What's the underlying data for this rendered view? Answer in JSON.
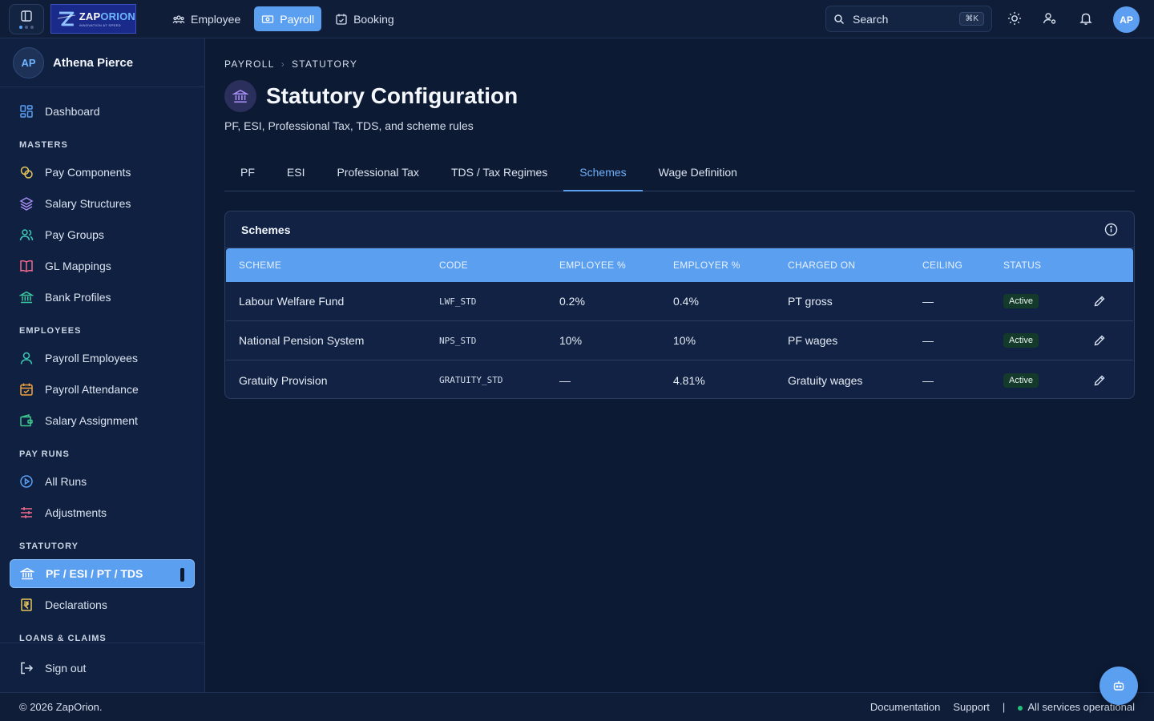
{
  "topbar": {
    "logo": {
      "wordmark_a": "ZAP",
      "wordmark_b": "ORION",
      "tagline": "INNOVATION AT SPEED"
    },
    "modules": [
      {
        "label": "Employee",
        "icon": "users-icon",
        "active": false
      },
      {
        "label": "Payroll",
        "icon": "banknote-icon",
        "active": true
      },
      {
        "label": "Booking",
        "icon": "calendar-check-icon",
        "active": false
      }
    ],
    "search": {
      "label": "Search",
      "shortcut": "⌘K"
    },
    "avatar_initials": "AP"
  },
  "sidebar": {
    "user": {
      "initials": "AP",
      "name": "Athena Pierce"
    },
    "items": {
      "dashboard": "Dashboard",
      "section_masters": "MASTERS",
      "pay_components": "Pay Components",
      "salary_structures": "Salary Structures",
      "pay_groups": "Pay Groups",
      "gl_mappings": "GL Mappings",
      "bank_profiles": "Bank Profiles",
      "section_employees": "EMPLOYEES",
      "payroll_employees": "Payroll Employees",
      "payroll_attendance": "Payroll Attendance",
      "salary_assignment": "Salary Assignment",
      "section_pay_runs": "PAY RUNS",
      "all_runs": "All Runs",
      "adjustments": "Adjustments",
      "section_statutory": "STATUTORY",
      "pf_esi_pt_tds": "PF / ESI / PT / TDS",
      "declarations": "Declarations",
      "section_loans": "LOANS & CLAIMS"
    },
    "sign_out": "Sign out"
  },
  "main": {
    "breadcrumb": [
      "PAYROLL",
      "STATUTORY"
    ],
    "title": "Statutory Configuration",
    "subtitle": "PF, ESI, Professional Tax, TDS, and scheme rules",
    "tabs": [
      "PF",
      "ESI",
      "Professional Tax",
      "TDS / Tax Regimes",
      "Schemes",
      "Wage Definition"
    ],
    "active_tab": "Schemes",
    "card_title": "Schemes",
    "columns": [
      "SCHEME",
      "CODE",
      "EMPLOYEE %",
      "EMPLOYER %",
      "CHARGED ON",
      "CEILING",
      "STATUS"
    ],
    "rows": [
      {
        "scheme": "Labour Welfare Fund",
        "code": "LWF_STD",
        "employee": "0.2%",
        "employer": "0.4%",
        "charged_on": "PT gross",
        "ceiling": "—",
        "status": "Active"
      },
      {
        "scheme": "National Pension System",
        "code": "NPS_STD",
        "employee": "10%",
        "employer": "10%",
        "charged_on": "PF wages",
        "ceiling": "—",
        "status": "Active"
      },
      {
        "scheme": "Gratuity Provision",
        "code": "GRATUITY_STD",
        "employee": "—",
        "employer": "4.81%",
        "charged_on": "Gratuity wages",
        "ceiling": "—",
        "status": "Active"
      }
    ]
  },
  "footer": {
    "copyright": "© 2026 ZapOrion.",
    "documentation": "Documentation",
    "support": "Support",
    "separator": "|",
    "status": "All services operational"
  },
  "colors": {
    "accent": "#5a9ff0",
    "background": "#0d1a33",
    "status_ok": "#22c07a"
  }
}
